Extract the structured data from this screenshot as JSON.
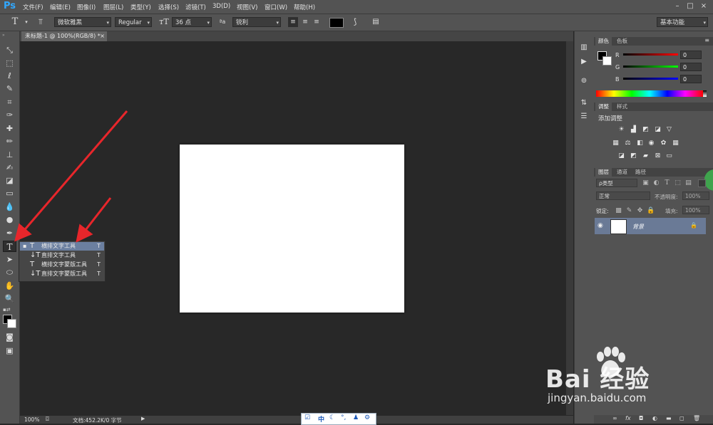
{
  "app": {
    "logo": "Ps"
  },
  "menu": [
    "文件(F)",
    "编辑(E)",
    "图像(I)",
    "图层(L)",
    "类型(Y)",
    "选择(S)",
    "滤镜(T)",
    "3D(D)",
    "视图(V)",
    "窗口(W)",
    "帮助(H)"
  ],
  "options": {
    "font_family": "微软雅黑",
    "font_style": "Regular",
    "font_size": "36 点",
    "aa_icon_label": "ªa",
    "antialias": "锐利",
    "workspace": "基本功能"
  },
  "document": {
    "tab_title": "未标题-1 @ 100%(RGB/8) *",
    "close_glyph": "×"
  },
  "flyout": {
    "items": [
      {
        "label": "横排文字工具",
        "shortcut": "T",
        "selected": true
      },
      {
        "label": "直排文字工具",
        "shortcut": "T",
        "selected": false
      },
      {
        "label": "横排文字蒙版工具",
        "shortcut": "T",
        "selected": false
      },
      {
        "label": "直排文字蒙版工具",
        "shortcut": "T",
        "selected": false
      }
    ]
  },
  "status": {
    "zoom": "100%",
    "doc_info": "文档:452.2K/0 字节"
  },
  "ime": {
    "mode": "中"
  },
  "color_panel": {
    "tabs": [
      "颜色",
      "色板"
    ],
    "channels": [
      {
        "name": "R",
        "value": "0"
      },
      {
        "name": "G",
        "value": "0"
      },
      {
        "name": "B",
        "value": "0"
      }
    ]
  },
  "adjust_panel": {
    "tabs": [
      "调整",
      "样式"
    ],
    "title": "添加调整"
  },
  "layers_panel": {
    "tabs": [
      "图层",
      "通道",
      "路径"
    ],
    "filter": "ρ类型",
    "blend_mode": "正常",
    "opacity_label": "不透明度:",
    "opacity_value": "100%",
    "lock_label": "锁定:",
    "fill_label": "填充:",
    "fill_value": "100%",
    "layer_name": "背景"
  },
  "watermark": {
    "logo": "Bai  经验",
    "url": "jingyan.baidu.com"
  },
  "colors": {
    "accent": "#31a8ff",
    "selection": "#6b7fa0",
    "arrow": "#e8262b"
  }
}
